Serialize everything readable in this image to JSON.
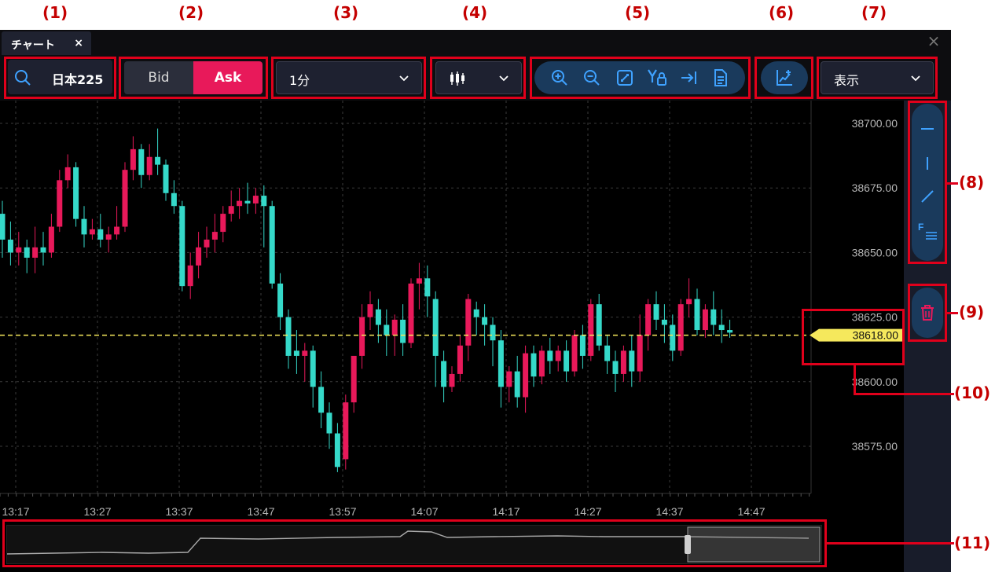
{
  "tab": {
    "title": "チャート",
    "close": "×"
  },
  "window_close": "×",
  "toolbar": {
    "symbol": "日本225",
    "bid_label": "Bid",
    "ask_label": "Ask",
    "period": "1分",
    "display": "表示"
  },
  "colors": {
    "up": "#e8195a",
    "down": "#35d9c9",
    "current_price": "#f5e85c",
    "toolbar_accent": "#1a3a5c",
    "annotation": "#e0001b"
  },
  "icons": {
    "search": "search-icon",
    "zoom": [
      "zoom-in-icon",
      "zoom-out-icon",
      "fit-screen-icon",
      "y-axis-lock-icon",
      "jump-to-latest-icon",
      "document-icon"
    ],
    "indicator": "indicator-icon",
    "draw": [
      "horizontal-line-icon",
      "vertical-line-icon",
      "trend-line-icon",
      "fibonacci-icon"
    ],
    "trash": "trash-icon"
  },
  "chart_data": {
    "type": "candlestick",
    "y_ticks": [
      "38700.00",
      "38675.00",
      "38650.00",
      "38625.00",
      "38600.00",
      "38575.00"
    ],
    "x_ticks": [
      "13:17",
      "13:27",
      "13:37",
      "13:47",
      "13:57",
      "14:07",
      "14:17",
      "14:27",
      "14:37",
      "14:47"
    ],
    "ylim": [
      38560,
      38710
    ],
    "current_price": "38618.00",
    "grid": true,
    "candles": [
      [
        38665,
        38670,
        38655,
        38648
      ],
      [
        38655,
        38662,
        38650,
        38645
      ],
      [
        38650,
        38658,
        38652,
        38645
      ],
      [
        38652,
        38655,
        38648,
        38642
      ],
      [
        38648,
        38660,
        38652,
        38642
      ],
      [
        38652,
        38658,
        38650,
        38645
      ],
      [
        38650,
        38665,
        38660,
        38648
      ],
      [
        38660,
        38682,
        38678,
        38658
      ],
      [
        38678,
        38688,
        38683,
        38675
      ],
      [
        38683,
        38685,
        38663,
        38660
      ],
      [
        38663,
        38668,
        38657,
        38652
      ],
      [
        38657,
        38663,
        38659,
        38655
      ],
      [
        38659,
        38665,
        38655,
        38652
      ],
      [
        38655,
        38660,
        38657,
        38650
      ],
      [
        38657,
        38668,
        38660,
        38655
      ],
      [
        38660,
        38685,
        38682,
        38658
      ],
      [
        38682,
        38695,
        38690,
        38678
      ],
      [
        38690,
        38692,
        38680,
        38675
      ],
      [
        38680,
        38692,
        38687,
        38678
      ],
      [
        38687,
        38698,
        38684,
        38680
      ],
      [
        38684,
        38686,
        38673,
        38670
      ],
      [
        38673,
        38678,
        38668,
        38665
      ],
      [
        38668,
        38670,
        38637,
        38635
      ],
      [
        38637,
        38650,
        38645,
        38632
      ],
      [
        38645,
        38658,
        38652,
        38640
      ],
      [
        38652,
        38660,
        38655,
        38648
      ],
      [
        38655,
        38665,
        38658,
        38650
      ],
      [
        38658,
        38668,
        38665,
        38654
      ],
      [
        38665,
        38674,
        38668,
        38662
      ],
      [
        38668,
        38675,
        38670,
        38663
      ],
      [
        38670,
        38677,
        38669,
        38665
      ],
      [
        38669,
        38675,
        38672,
        38665
      ],
      [
        38672,
        38676,
        38668,
        38652
      ],
      [
        38668,
        38670,
        38638,
        38636
      ],
      [
        38638,
        38642,
        38625,
        38620
      ],
      [
        38625,
        38628,
        38610,
        38605
      ],
      [
        38612,
        38620,
        38610,
        38603
      ],
      [
        38610,
        38615,
        38612,
        38600
      ],
      [
        38612,
        38614,
        38598,
        38590
      ],
      [
        38598,
        38604,
        38588,
        38582
      ],
      [
        38588,
        38592,
        38580,
        38574
      ],
      [
        38580,
        38584,
        38567,
        38565
      ],
      [
        38570,
        38595,
        38592,
        38566
      ],
      [
        38592,
        38606,
        38610,
        38588
      ],
      [
        38610,
        38630,
        38625,
        38605
      ],
      [
        38625,
        38635,
        38630,
        38620
      ],
      [
        38628,
        38632,
        38622,
        38615
      ],
      [
        38622,
        38628,
        38618,
        38610
      ],
      [
        38618,
        38626,
        38624,
        38610
      ],
      [
        38624,
        38630,
        38615,
        38610
      ],
      [
        38615,
        38640,
        38638,
        38613
      ],
      [
        38638,
        38646,
        38640,
        38628
      ],
      [
        38640,
        38645,
        38633,
        38625
      ],
      [
        38632,
        38635,
        38610,
        38598
      ],
      [
        38608,
        38612,
        38598,
        38592
      ],
      [
        38598,
        38606,
        38603,
        38596
      ],
      [
        38603,
        38618,
        38614,
        38600
      ],
      [
        38614,
        38634,
        38632,
        38608
      ],
      [
        38628,
        38631,
        38625,
        38618
      ],
      [
        38625,
        38630,
        38622,
        38614
      ],
      [
        38622,
        38625,
        38616,
        38606
      ],
      [
        38616,
        38620,
        38598,
        38590
      ],
      [
        38598,
        38606,
        38604,
        38592
      ],
      [
        38604,
        38610,
        38594,
        38590
      ],
      [
        38594,
        38614,
        38611,
        38588
      ],
      [
        38611,
        38614,
        38602,
        38598
      ],
      [
        38602,
        38614,
        38612,
        38599
      ],
      [
        38612,
        38617,
        38608,
        38603
      ],
      [
        38608,
        38614,
        38612,
        38604
      ],
      [
        38612,
        38616,
        38604,
        38600
      ],
      [
        38604,
        38620,
        38618,
        38602
      ],
      [
        38618,
        38622,
        38610,
        38605
      ],
      [
        38610,
        38632,
        38630,
        38608
      ],
      [
        38630,
        38634,
        38614,
        38612
      ],
      [
        38614,
        38618,
        38608,
        38603
      ],
      [
        38608,
        38612,
        38603,
        38596
      ],
      [
        38603,
        38614,
        38612,
        38600
      ],
      [
        38612,
        38618,
        38604,
        38598
      ],
      [
        38604,
        38626,
        38618,
        38600
      ],
      [
        38618,
        38632,
        38630,
        38612
      ],
      [
        38630,
        38635,
        38624,
        38620
      ],
      [
        38624,
        38630,
        38622,
        38615
      ],
      [
        38622,
        38626,
        38612,
        38608
      ],
      [
        38612,
        38632,
        38630,
        38610
      ],
      [
        38630,
        38640,
        38632,
        38625
      ],
      [
        38632,
        38636,
        38620,
        38618
      ],
      [
        38620,
        38630,
        38628,
        38617
      ],
      [
        38628,
        38635,
        38622,
        38618
      ],
      [
        38622,
        38628,
        38620,
        38615
      ],
      [
        38620,
        38624,
        38619,
        38617
      ]
    ]
  }
}
